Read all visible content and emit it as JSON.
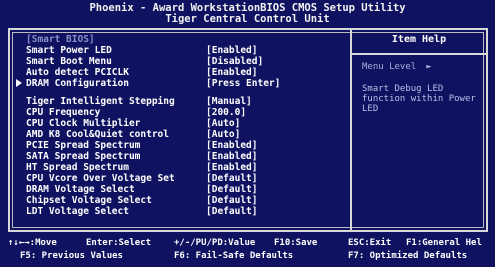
{
  "title": {
    "line1": "Phoenix - Award WorkstationBIOS CMOS Setup Utility",
    "line2": "Tiger Central Control Unit"
  },
  "settings": [
    {
      "label": "[Smart BIOS]",
      "value": ""
    },
    {
      "label": "Smart Power LED",
      "value": "[Enabled]"
    },
    {
      "label": "Smart Boot Menu",
      "value": "[Disabled]"
    },
    {
      "label": "Auto detect PCICLK",
      "value": "[Enabled]"
    },
    {
      "label": "DRAM Configuration",
      "value": "[Press Enter]"
    },
    {
      "label": "Tiger Intelligent Stepping",
      "value": "[Manual]"
    },
    {
      "label": "CPU Frequency",
      "value": "[200.0]"
    },
    {
      "label": "CPU Clock Multiplier",
      "value": "[Auto]"
    },
    {
      "label": "AMD K8 Cool&Quiet control",
      "value": "[Auto]"
    },
    {
      "label": "PCIE Spread Spectrum",
      "value": "[Enabled]"
    },
    {
      "label": "SATA Spread Spectrum",
      "value": "[Enabled]"
    },
    {
      "label": "HT Spread Spectrum",
      "value": "[Enabled]"
    },
    {
      "label": "CPU Vcore Over Voltage Set",
      "value": "[Default]"
    },
    {
      "label": "DRAM Voltage Select",
      "value": "[Default]"
    },
    {
      "label": "Chipset Voltage Select",
      "value": "[Default]"
    },
    {
      "label": "LDT Voltage Select",
      "value": "[Default]"
    }
  ],
  "help": {
    "title": "Item Help",
    "menu_level": "Menu Level",
    "menu_arrow": "►",
    "text": "Smart Debug LED function within Power LED"
  },
  "footer": {
    "nav": "↑↓←→:Move",
    "select": "Enter:Select",
    "value": "+/-/PU/PD:Value",
    "save": "F10:Save",
    "exit": "ESC:Exit",
    "general_help": "F1:General Hel",
    "previous": "F5: Previous Values",
    "failsafe": "F6: Fail-Safe Defaults",
    "optimized": "F7: Optimized Defaults"
  },
  "colors": {
    "background": "#0f1260",
    "text": "#ffffff",
    "dim_text": "#8a90c8",
    "border": "#d8d8d8"
  }
}
